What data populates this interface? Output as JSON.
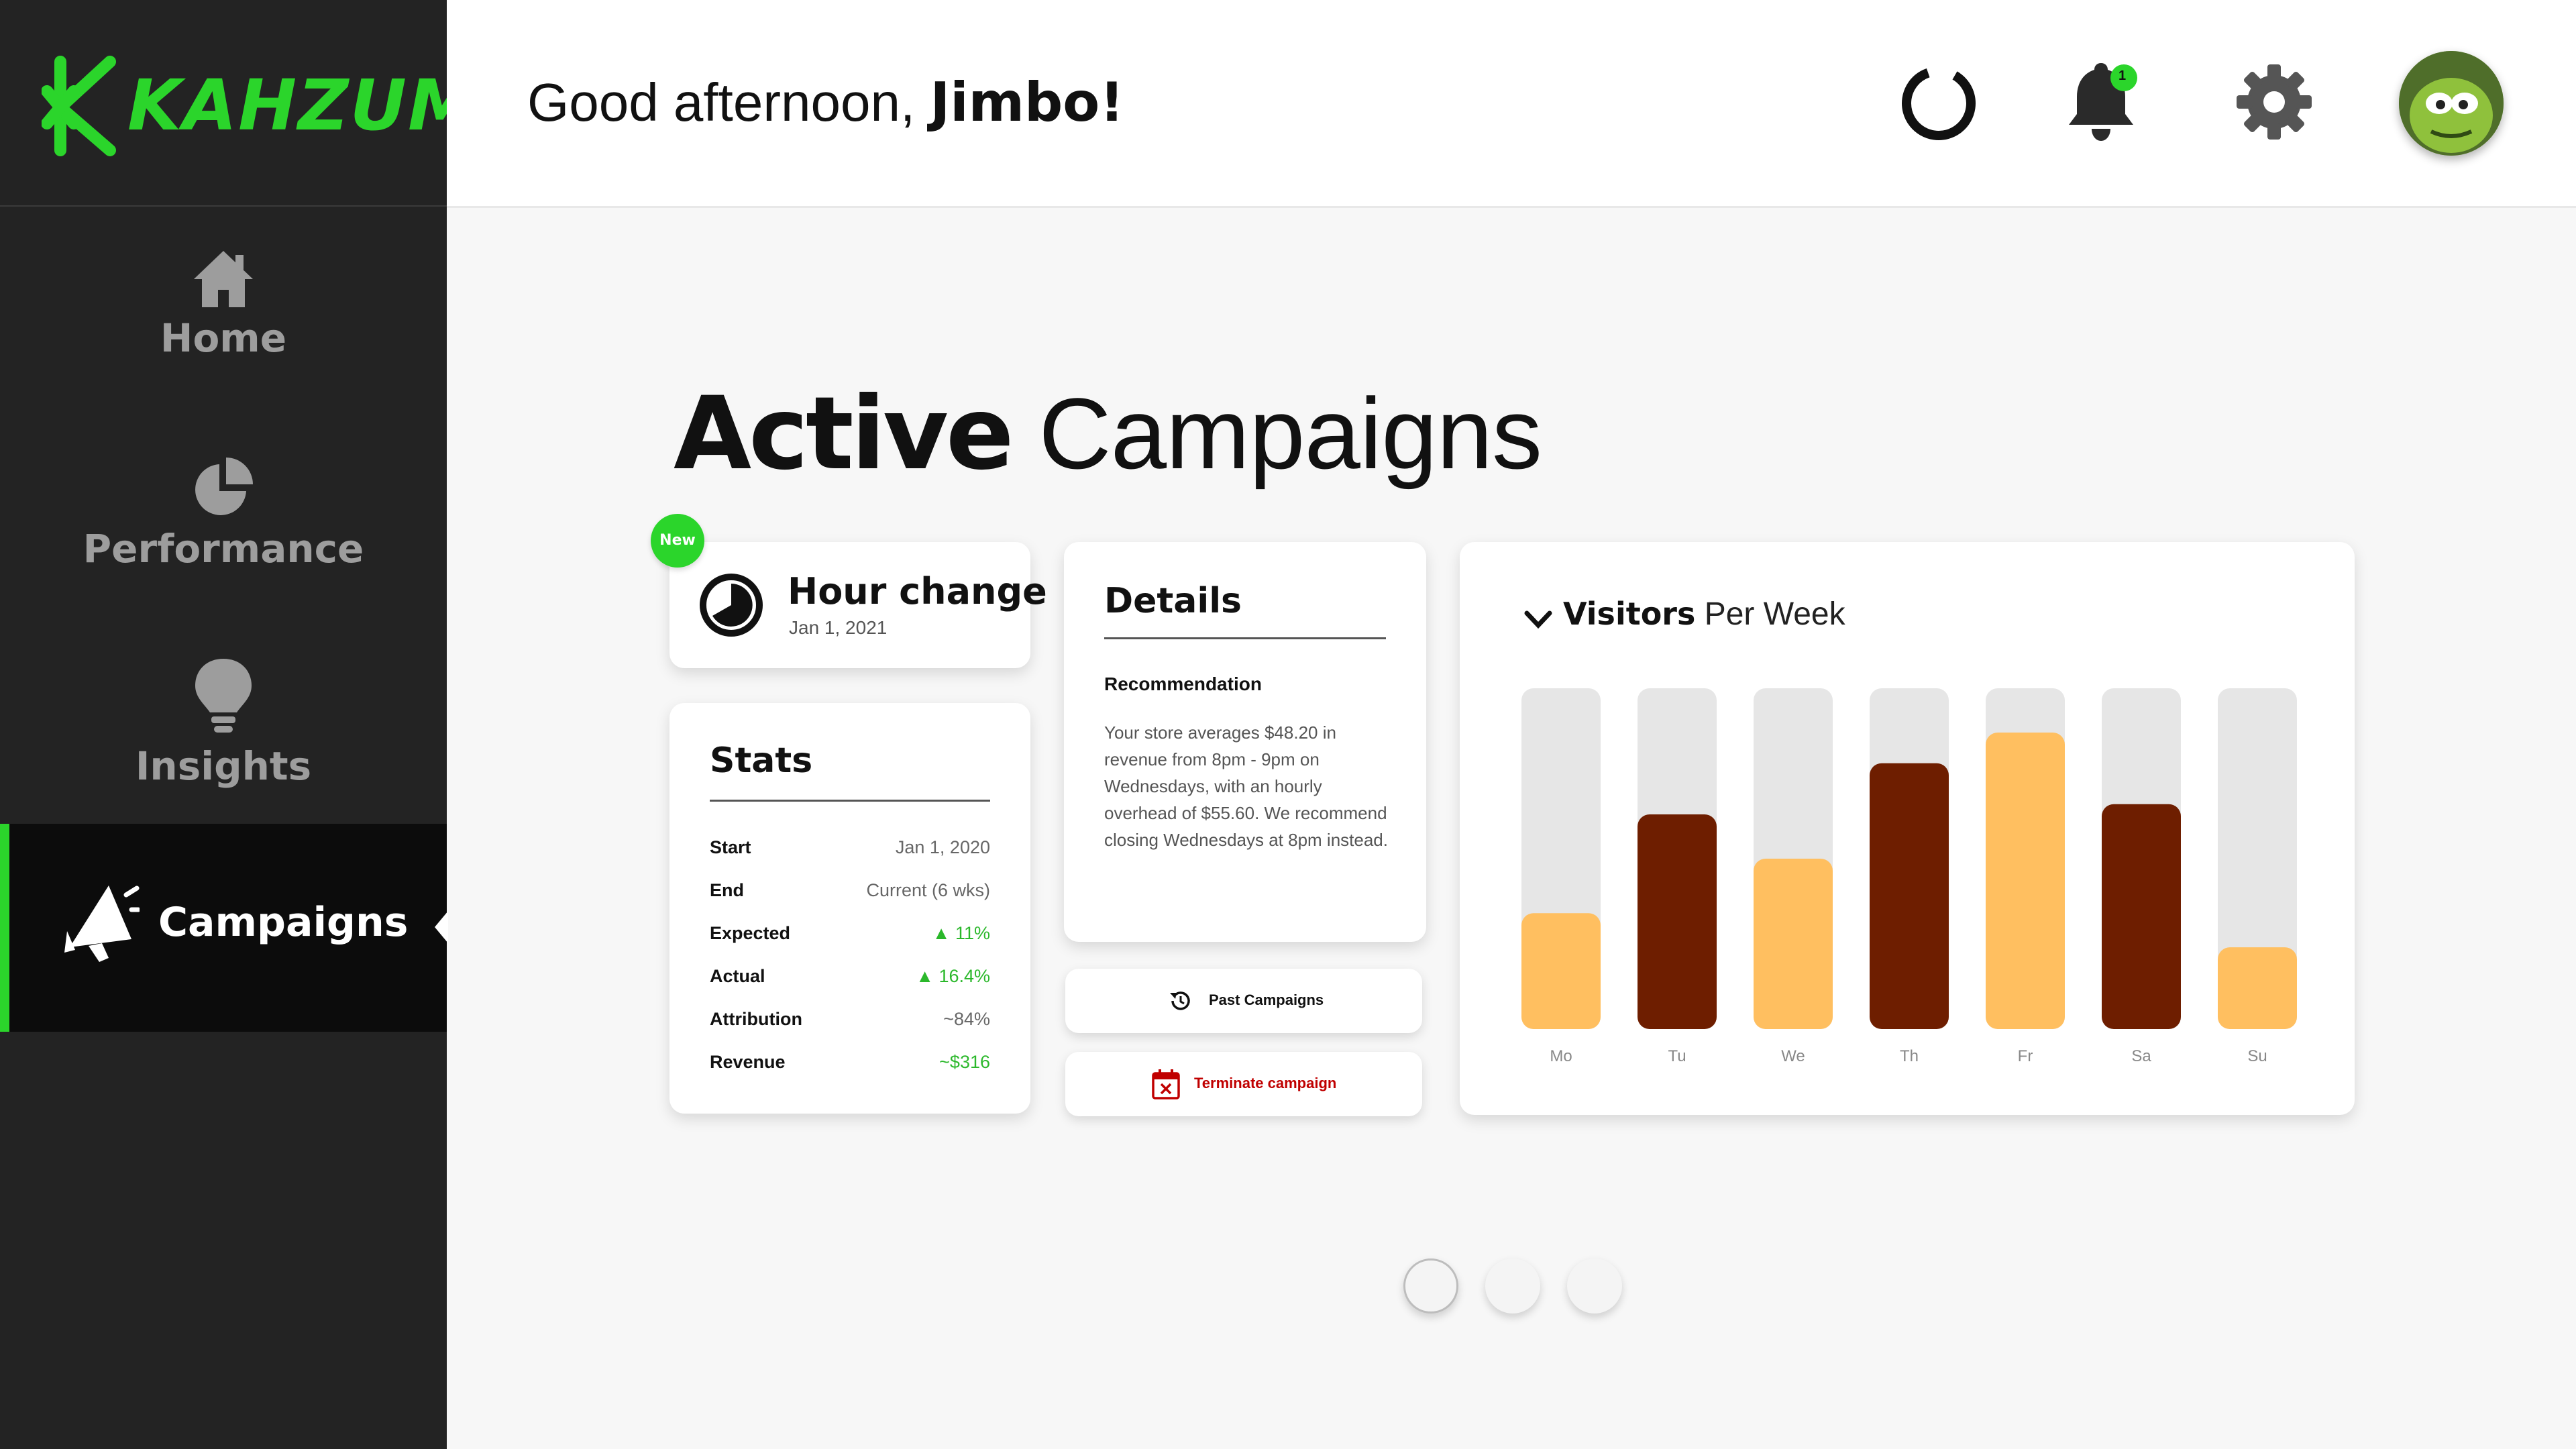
{
  "brand": {
    "name": "KAHZUM",
    "accent": "#2bd52b"
  },
  "sidebar": {
    "items": [
      {
        "label": "Home",
        "icon": "home-icon"
      },
      {
        "label": "Performance",
        "icon": "pie-chart-icon"
      },
      {
        "label": "Insights",
        "icon": "lightbulb-icon"
      },
      {
        "label": "Campaigns",
        "icon": "megaphone-icon",
        "active": true
      }
    ]
  },
  "header": {
    "greeting": "Good afternoon,",
    "user_name": "Jimbo!",
    "notification_count": "1",
    "icons": [
      "loading-ring-icon",
      "bell-icon",
      "gear-icon",
      "avatar"
    ]
  },
  "main": {
    "title_bold": "Active",
    "title_light": "Campaigns",
    "campaign": {
      "badge": "New",
      "title": "Hour change",
      "date": "Jan 1, 2021"
    },
    "stats": {
      "title": "Stats",
      "rows": [
        {
          "key": "Start",
          "value": "Jan 1, 2020",
          "trend": ""
        },
        {
          "key": "End",
          "value": "Current (6 wks)",
          "trend": ""
        },
        {
          "key": "Expected",
          "value": "11%",
          "trend": "up"
        },
        {
          "key": "Actual",
          "value": "16.4%",
          "trend": "up"
        },
        {
          "key": "Attribution",
          "value": "~84%",
          "trend": ""
        },
        {
          "key": "Revenue",
          "value": "~$316",
          "trend": "positive"
        }
      ]
    },
    "details": {
      "title": "Details",
      "recommendation_label": "Recommendation",
      "recommendation_text": "Your store averages $48.20 in revenue from 8pm - 9pm on Wednesdays, with an hourly overhead of $55.60. We recommend closing Wednesdays at 8pm instead."
    },
    "buttons": {
      "past_campaigns": "Past Campaigns",
      "terminate": "Terminate campaign"
    },
    "pager": {
      "pages": 3,
      "current": 1
    }
  },
  "chart_data": {
    "type": "bar",
    "title_bold": "Visitors",
    "title_light": "Per Week",
    "categories": [
      "Mo",
      "Tu",
      "We",
      "Th",
      "Fr",
      "Sa",
      "Su"
    ],
    "values": [
      34,
      63,
      50,
      78,
      87,
      66,
      24
    ],
    "ylim": [
      0,
      100
    ],
    "colors": [
      "#ffbf60",
      "#6e1e00",
      "#ffbf60",
      "#6e1e00",
      "#ffbf60",
      "#6e1e00",
      "#ffbf60"
    ],
    "track_color": "#e6e6e6",
    "grid": false,
    "legend": "none"
  }
}
